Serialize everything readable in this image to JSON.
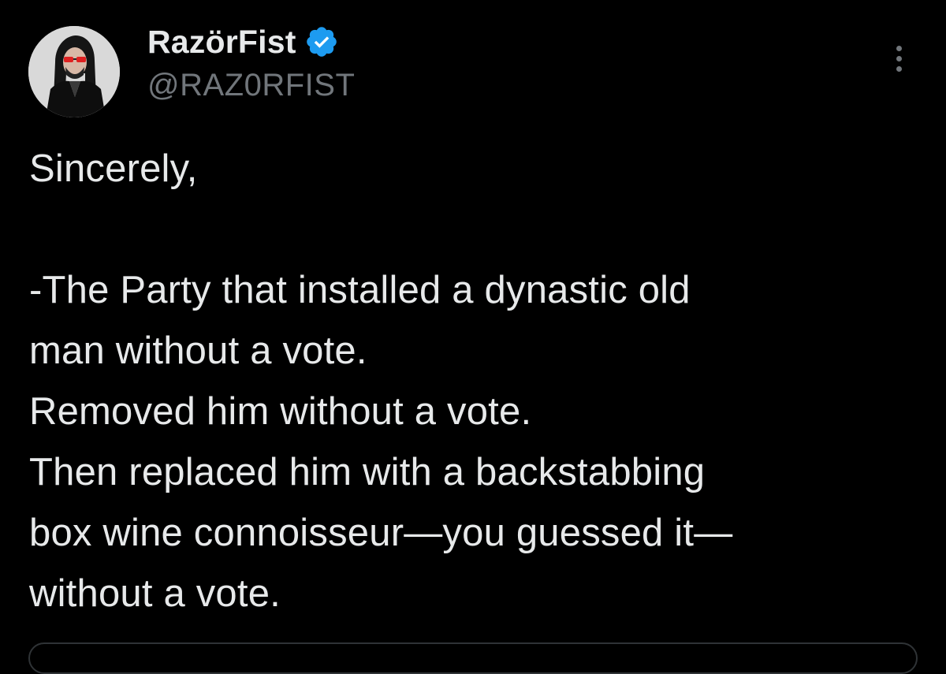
{
  "author": {
    "display_name": "RazörFist",
    "handle": "@RAZ0RFIST",
    "verified_icon": "verified-badge-icon",
    "avatar_icon": "avatar"
  },
  "menu": {
    "icon": "more-options-icon"
  },
  "tweet": {
    "lines": [
      "Sincerely,",
      "",
      "-The Party that installed a dynastic old",
      "man without a vote.",
      "Removed him without a vote.",
      "Then replaced him with a backstabbing",
      "box wine connoisseur—you guessed it—",
      "without a vote."
    ]
  },
  "colors": {
    "background": "#000000",
    "text_primary": "#e7e9ea",
    "text_secondary": "#71767b",
    "verified_blue": "#1d9bf0"
  }
}
